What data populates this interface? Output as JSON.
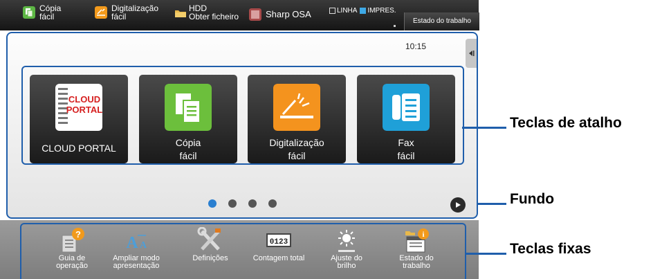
{
  "topbar": {
    "items": [
      {
        "label": "Cópia\nfácil",
        "icon": "copy-icon",
        "color": "#5db744"
      },
      {
        "label": "Digitalização\nfácil",
        "icon": "scan-icon",
        "color": "#f39a1c"
      },
      {
        "label": "HDD\nObter ficheiro",
        "icon": "folder-icon",
        "color": "#e8b84a"
      },
      {
        "label": "Sharp OSA",
        "icon": "osa-icon",
        "color": "#c0504d"
      }
    ],
    "line_label": "LINHA",
    "print_label": "IMPRES.",
    "job_status_label": "Estado do trabalho"
  },
  "home": {
    "time": "10:15",
    "tiles": [
      {
        "label": "CLOUD PORTAL",
        "icon": "cloud-portal-icon",
        "color": "#ffffff"
      },
      {
        "label": "Cópia\nfácil",
        "icon": "copy-icon",
        "color": "#6cbf3c"
      },
      {
        "label": "Digitalização\nfácil",
        "icon": "scan-icon",
        "color": "#f4931e"
      },
      {
        "label": "Fax\nfácil",
        "icon": "fax-icon",
        "color": "#1fa0d8"
      }
    ],
    "page_count": 4,
    "active_page": 1
  },
  "fixed_keys": [
    {
      "label": "Guia de\noperação",
      "icon": "help-guide-icon"
    },
    {
      "label": "Ampliar modo\napresentação",
      "icon": "enlarge-text-icon"
    },
    {
      "label": "Definições",
      "icon": "settings-tools-icon"
    },
    {
      "label": "Contagem total",
      "icon": "counter-icon"
    },
    {
      "label": "Ajuste do\nbrilho",
      "icon": "brightness-icon"
    },
    {
      "label": "Estado do\ntrabalho",
      "icon": "job-status-icon"
    }
  ],
  "callouts": {
    "shortcut_keys": "Teclas de atalho",
    "background": "Fundo",
    "fixed_keys": "Teclas fixas"
  },
  "colors": {
    "frame_blue": "#1f5eab",
    "page_active": "#2a7fd0"
  }
}
